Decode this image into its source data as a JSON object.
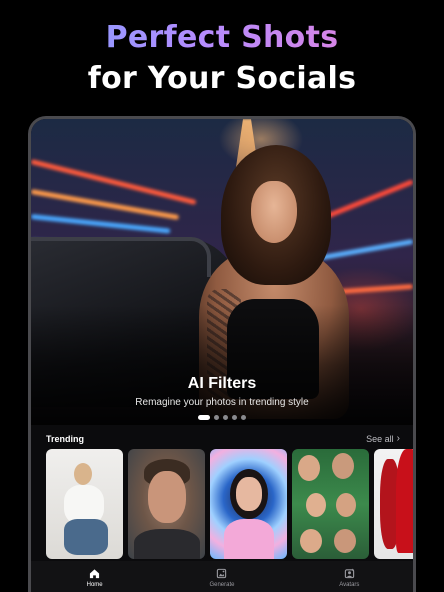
{
  "headline": {
    "line1": "Perfect Shots",
    "line2": "for Your Socials"
  },
  "hero": {
    "title": "AI Filters",
    "subtitle": "Remagine your photos in trending style",
    "carousel_page_count": 5,
    "carousel_active_index": 0
  },
  "trending": {
    "title": "Trending",
    "see_all_label": "See all",
    "see_all_icon": "chevron-right-icon",
    "items": [
      {
        "name": "woman-on-chair"
      },
      {
        "name": "man-portrait"
      },
      {
        "name": "girl-bubble-portal"
      },
      {
        "name": "family-collage"
      },
      {
        "name": "red-heels"
      }
    ]
  },
  "tabbar": {
    "tabs": [
      {
        "label": "Home",
        "icon": "home-icon",
        "active": true
      },
      {
        "label": "Generate",
        "icon": "generate-icon",
        "active": false
      },
      {
        "label": "Avatars",
        "icon": "avatars-icon",
        "active": false
      }
    ]
  },
  "colors": {
    "headline_gradient": [
      "#7aa2ff",
      "#b48cff",
      "#f07fd4"
    ],
    "background": "#000000",
    "device_frame": "#4a4a4e"
  }
}
